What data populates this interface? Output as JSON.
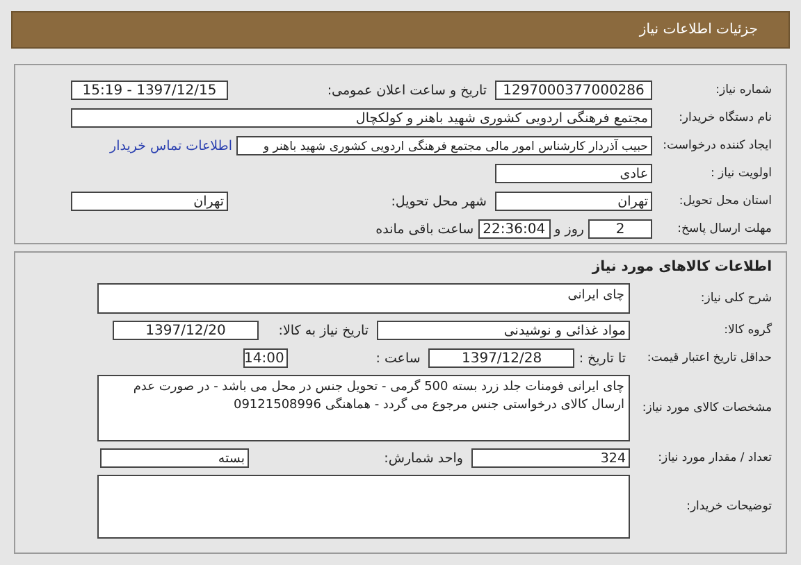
{
  "header": {
    "title": "جزئیات اطلاعات نیاز"
  },
  "need_info": {
    "need_number": {
      "label": "شماره نیاز:",
      "value": "1297000377000286"
    },
    "announce_datetime": {
      "label": "تاریخ و ساعت اعلان عمومی:",
      "value": "1397/12/15 - 15:19"
    },
    "buyer_org": {
      "label": "نام دستگاه خریدار:",
      "value": "مجتمع فرهنگی اردویی کشوری شهید باهنر و کولکچال"
    },
    "requester": {
      "label": "ایجاد کننده درخواست:",
      "value": "حبیب آذردار کارشناس امور مالی  مجتمع فرهنگی اردویی کشوری شهید باهنر و",
      "link": "اطلاعات تماس خریدار"
    },
    "priority": {
      "label": "اولویت نیاز :",
      "value": "عادی"
    },
    "province": {
      "label": "استان محل تحویل:",
      "value": "تهران"
    },
    "city": {
      "label": "شهر محل تحویل:",
      "value": "تهران"
    },
    "deadline": {
      "label": "مهلت ارسال پاسخ:",
      "days": "2",
      "days_suffix": "روز و",
      "time": "22:36:04",
      "time_suffix": "ساعت باقی مانده"
    }
  },
  "goods": {
    "title": "اطلاعات کالاهای مورد نیاز",
    "summary": {
      "label": "شرح کلی نیاز:",
      "value": "چای ایرانی"
    },
    "group": {
      "label": "گروه کالا:",
      "value": "مواد غذائی و نوشیدنی"
    },
    "need_date": {
      "label": "تاریخ نیاز به کالا:",
      "value": "1397/12/20"
    },
    "price_validity": {
      "label": "حداقل تاریخ اعتبار قیمت:",
      "date_label": "تا تاریخ :",
      "date": "1397/12/28",
      "time_label": "ساعت :",
      "time": "14:00"
    },
    "specs": {
      "label": "مشخصات کالای مورد نیاز:",
      "value": "چای ایرانی فومنات جلد زرد بسته 500 گرمی - تحویل جنس در محل می باشد - در صورت عدم ارسال کالای درخواستی جنس مرجوع می گردد - هماهنگی 09121508996"
    },
    "quantity": {
      "label": "تعداد / مقدار مورد نیاز:",
      "value": "324"
    },
    "unit": {
      "label": "واحد شمارش:",
      "value": "بسته"
    },
    "buyer_notes": {
      "label": "توضیحات خریدار:"
    }
  }
}
